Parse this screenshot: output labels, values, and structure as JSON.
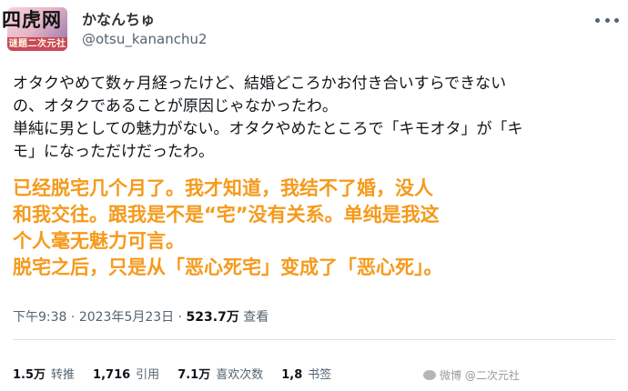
{
  "watermark_top": "四虎网",
  "avatar_tag": "谜题二次元社",
  "author": {
    "display_name": "かなんちゅ",
    "handle": "@otsu_kananchu2"
  },
  "tweet": {
    "jp_lines": [
      "オタクやめて数ヶ月経ったけど、結婚どころかお付き合いすらできないの、オタクであることが原因じゃなかったわ。",
      "単純に男としての魅力がない。オタクやめたところで「キモオタ」が「キモ」になっただけだったわ。"
    ],
    "cn_lines": [
      "已经脱宅几个月了。我才知道，我结不了婚，没人",
      "和我交往。跟我是不是“宅”没有关系。单纯是我这",
      "个人毫无魅力可言。",
      "脱宅之后，只是从「恶心死宅」变成了「恶心死」。"
    ]
  },
  "meta": {
    "time": "下午9:38",
    "separator": "·",
    "date": "2023年5月23日",
    "views": "523.7万",
    "views_label": "查看"
  },
  "stats": {
    "retweets_value": "1.5万",
    "retweets_label": "转推",
    "quotes_value": "1,716",
    "quotes_label": "引用",
    "likes_value": "7.1万",
    "likes_label": "喜欢次数",
    "bookmarks_value": "1,8",
    "bookmarks_label": "书签"
  },
  "watermark_bottom": "微博 @二次元社"
}
